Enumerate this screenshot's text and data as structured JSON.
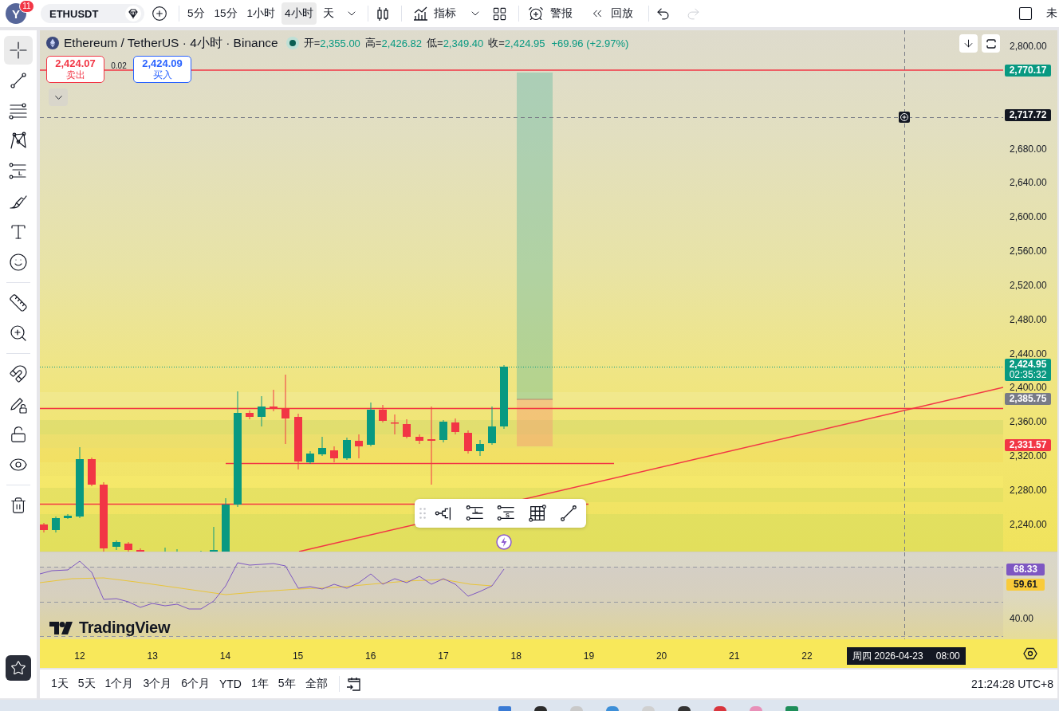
{
  "header": {
    "avatar": {
      "letter": "Y",
      "badge": "11"
    },
    "symbol": "ETHUSDT",
    "intervals": [
      {
        "label": "5分",
        "selected": false
      },
      {
        "label": "15分",
        "selected": false
      },
      {
        "label": "1小时",
        "selected": false
      },
      {
        "label": "4小时",
        "selected": true
      },
      {
        "label": "天",
        "selected": false
      }
    ],
    "indicators": "指标",
    "alert": "警报",
    "replay": "回放",
    "history": [
      {
        "kind": "undo",
        "disabled": false
      },
      {
        "kind": "redo",
        "disabled": true
      }
    ],
    "edge_text": "未"
  },
  "tools": [
    {
      "kind": "crosshair",
      "selected": true
    },
    {
      "kind": "trend-line",
      "selected": false
    },
    {
      "kind": "fib",
      "selected": false
    },
    {
      "kind": "pattern",
      "selected": false
    },
    {
      "kind": "long-short",
      "selected": false,
      "glyph": "L"
    },
    {
      "kind": "brush",
      "selected": false
    },
    {
      "kind": "text",
      "selected": false
    },
    {
      "kind": "emoji",
      "selected": false
    },
    {
      "kind": "ruler",
      "selected": false
    },
    {
      "kind": "zoom",
      "selected": false
    },
    {
      "kind": "magnet",
      "selected": false
    },
    {
      "kind": "lock-drawing",
      "selected": false
    },
    {
      "kind": "lock",
      "selected": false
    },
    {
      "kind": "hide",
      "selected": false
    },
    {
      "kind": "trash",
      "selected": false
    }
  ],
  "legend": {
    "title": "Ethereum / TetherUS · 4小时 · Binance",
    "ohlc": [
      {
        "label": "开=",
        "value": "2,355.00"
      },
      {
        "label": "高=",
        "value": "2,426.82"
      },
      {
        "label": "低=",
        "value": "2,349.40"
      },
      {
        "label": "收=",
        "value": "2,424.95"
      }
    ],
    "change": "+69.96 (+2.97%)"
  },
  "trade": {
    "sell": {
      "price": "2,424.07",
      "label": "卖出"
    },
    "spread": "0.02",
    "buy": {
      "price": "2,424.09",
      "label": "买入"
    }
  },
  "drawing_toolbar": [
    {
      "kind": "fork"
    },
    {
      "kind": "long",
      "glyph": "L"
    },
    {
      "kind": "short",
      "glyph": "S"
    },
    {
      "kind": "grid"
    },
    {
      "kind": "line"
    }
  ],
  "price_axis": {
    "labels": [
      "2,800.00",
      "2,680.00",
      "2,640.00",
      "2,600.00",
      "2,560.00",
      "2,520.00",
      "2,480.00",
      "2,440.00",
      "2,400.00",
      "2,360.00",
      "2,320.00",
      "2,280.00",
      "2,240.00"
    ],
    "tags": [
      {
        "text": "2,770.17",
        "color": "#089981"
      },
      {
        "text": "2,717.72",
        "color": "#131722"
      },
      {
        "text": "2,424.95",
        "sub": "02:35:32",
        "color": "#089981"
      },
      {
        "text": "2,385.75",
        "color": "#787b86"
      },
      {
        "text": "2,331.57",
        "color": "#f23645"
      }
    ]
  },
  "rsi": {
    "labels": [
      "40.00"
    ],
    "tags": [
      {
        "text": "68.33",
        "color": "#7e57c2"
      },
      {
        "text": "59.61",
        "color": "#f9cb3a"
      }
    ]
  },
  "branding": "TradingView",
  "time_axis": {
    "labels": [
      "12",
      "13",
      "14",
      "15",
      "16",
      "17",
      "18",
      "19",
      "20",
      "21",
      "22"
    ],
    "crosshair": {
      "date": "周四 2026-04-23",
      "time": "08:00"
    }
  },
  "range_bar": {
    "ranges": [
      "1天",
      "5天",
      "1个月",
      "3个月",
      "6个月",
      "YTD",
      "1年",
      "5年",
      "全部"
    ],
    "clock": "21:24:28 UTC+8"
  }
}
